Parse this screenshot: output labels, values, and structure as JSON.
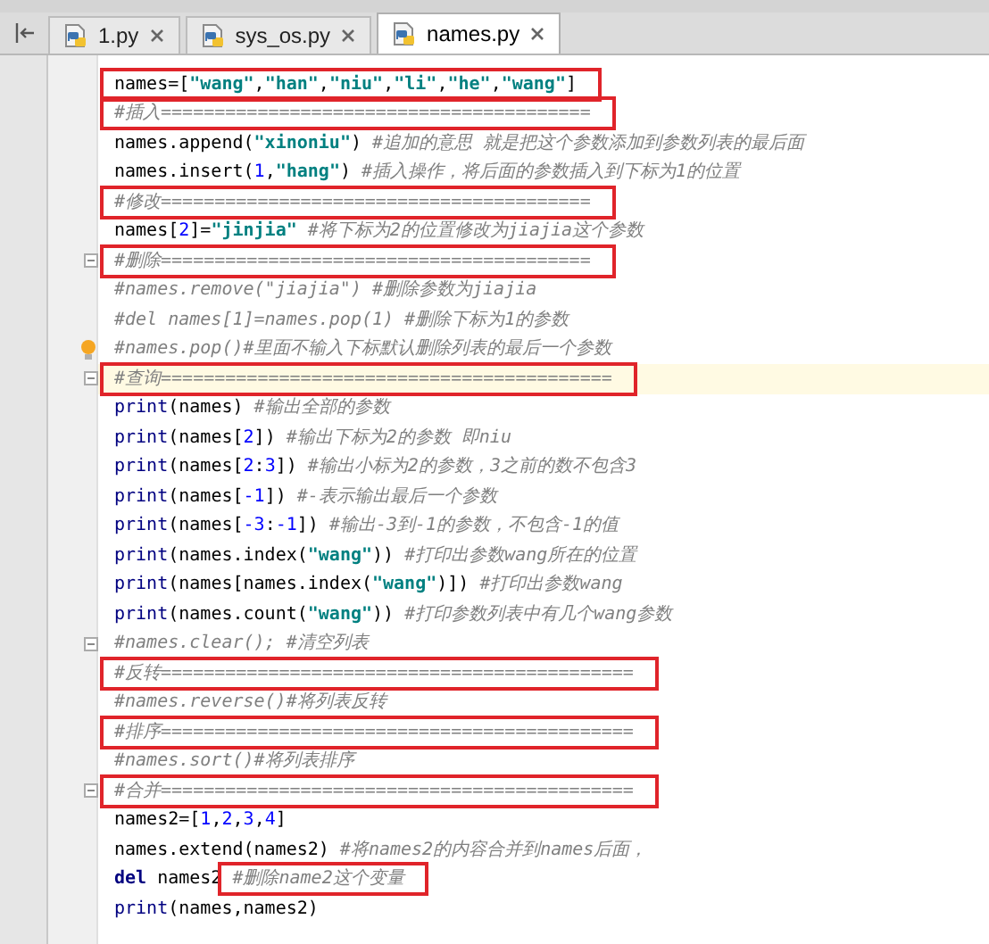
{
  "tabs": [
    {
      "label": "1.py",
      "selected": false
    },
    {
      "label": "sys_os.py",
      "selected": false
    },
    {
      "label": "names.py",
      "selected": true
    }
  ],
  "editor": {
    "lines": [
      {
        "code": [
          {
            "kind": "plain",
            "text": "names=["
          },
          {
            "kind": "string",
            "text": "\"wang\""
          },
          {
            "kind": "plain",
            "text": ","
          },
          {
            "kind": "string",
            "text": "\"han\""
          },
          {
            "kind": "plain",
            "text": ","
          },
          {
            "kind": "string",
            "text": "\"niu\""
          },
          {
            "kind": "plain",
            "text": ","
          },
          {
            "kind": "string",
            "text": "\"li\""
          },
          {
            "kind": "plain",
            "text": ","
          },
          {
            "kind": "string",
            "text": "\"he\""
          },
          {
            "kind": "plain",
            "text": ","
          },
          {
            "kind": "string",
            "text": "\"wang\""
          },
          {
            "kind": "plain",
            "text": "]"
          }
        ],
        "boxed": true
      },
      {
        "comment": "#插入========================================",
        "boxed": true
      },
      {
        "code": [
          {
            "kind": "plain",
            "text": "names.append("
          },
          {
            "kind": "string",
            "text": "\"xinoniu\""
          },
          {
            "kind": "plain",
            "text": ")"
          }
        ],
        "comment": "#追加的意思 就是把这个参数添加到参数列表的最后面"
      },
      {
        "code": [
          {
            "kind": "plain",
            "text": "names.insert("
          },
          {
            "kind": "number",
            "text": "1"
          },
          {
            "kind": "plain",
            "text": ","
          },
          {
            "kind": "string",
            "text": "\"hang\""
          },
          {
            "kind": "plain",
            "text": ")"
          }
        ],
        "comment": "#插入操作，将后面的参数插入到下标为1的位置"
      },
      {
        "comment": "#修改========================================",
        "boxed": true
      },
      {
        "code": [
          {
            "kind": "plain",
            "text": "names["
          },
          {
            "kind": "number",
            "text": "2"
          },
          {
            "kind": "plain",
            "text": "]="
          },
          {
            "kind": "string",
            "text": "\"jinjia\""
          }
        ],
        "comment": "#将下标为2的位置修改为jiajia这个参数"
      },
      {
        "comment": "#删除========================================",
        "boxed": true,
        "fold": true
      },
      {
        "comment": "#names.remove(\"jiajia\")  #删除参数为jiajia"
      },
      {
        "comment": "#del names[1]=names.pop(1) #删除下标为1的参数"
      },
      {
        "comment": "#names.pop()#里面不输入下标默认删除列表的最后一个参数",
        "bulb": true
      },
      {
        "comment": "#查询==========================================",
        "boxed": true,
        "fold": true,
        "current": true
      },
      {
        "code": [
          {
            "kind": "builtin",
            "text": "print"
          },
          {
            "kind": "plain",
            "text": "(names)"
          }
        ],
        "comment": "#输出全部的参数"
      },
      {
        "code": [
          {
            "kind": "builtin",
            "text": "print"
          },
          {
            "kind": "plain",
            "text": "(names["
          },
          {
            "kind": "number",
            "text": "2"
          },
          {
            "kind": "plain",
            "text": "])"
          }
        ],
        "comment": "#输出下标为2的参数 即niu"
      },
      {
        "code": [
          {
            "kind": "builtin",
            "text": "print"
          },
          {
            "kind": "plain",
            "text": "(names["
          },
          {
            "kind": "number",
            "text": "2"
          },
          {
            "kind": "plain",
            "text": ":"
          },
          {
            "kind": "number",
            "text": "3"
          },
          {
            "kind": "plain",
            "text": "])"
          }
        ],
        "comment": "#输出小标为2的参数，3之前的数不包含3"
      },
      {
        "code": [
          {
            "kind": "builtin",
            "text": "print"
          },
          {
            "kind": "plain",
            "text": "(names["
          },
          {
            "kind": "number",
            "text": "-1"
          },
          {
            "kind": "plain",
            "text": "])"
          }
        ],
        "comment": "#-表示输出最后一个参数"
      },
      {
        "code": [
          {
            "kind": "builtin",
            "text": "print"
          },
          {
            "kind": "plain",
            "text": "(names["
          },
          {
            "kind": "number",
            "text": "-3"
          },
          {
            "kind": "plain",
            "text": ":"
          },
          {
            "kind": "number",
            "text": "-1"
          },
          {
            "kind": "plain",
            "text": "])"
          }
        ],
        "comment": "#输出-3到-1的参数，不包含-1的值"
      },
      {
        "code": [
          {
            "kind": "builtin",
            "text": "print"
          },
          {
            "kind": "plain",
            "text": "(names.index("
          },
          {
            "kind": "string",
            "text": "\"wang\""
          },
          {
            "kind": "plain",
            "text": "))"
          }
        ],
        "comment": "#打印出参数wang所在的位置"
      },
      {
        "code": [
          {
            "kind": "builtin",
            "text": "print"
          },
          {
            "kind": "plain",
            "text": "(names[names.index("
          },
          {
            "kind": "string",
            "text": "\"wang\""
          },
          {
            "kind": "plain",
            "text": ")])"
          }
        ],
        "comment": "#打印出参数wang"
      },
      {
        "code": [
          {
            "kind": "builtin",
            "text": "print"
          },
          {
            "kind": "plain",
            "text": "(names.count("
          },
          {
            "kind": "string",
            "text": "\"wang\""
          },
          {
            "kind": "plain",
            "text": "))"
          }
        ],
        "comment": "#打印参数列表中有几个wang参数"
      },
      {
        "comment": "#names.clear(); #清空列表",
        "fold": true
      },
      {
        "comment": "#反转============================================",
        "boxed": true
      },
      {
        "comment": "#names.reverse()#将列表反转"
      },
      {
        "comment": "#排序============================================",
        "boxed": true
      },
      {
        "comment": "#names.sort()#将列表排序"
      },
      {
        "comment": "#合并============================================",
        "boxed": true,
        "fold": true
      },
      {
        "code": [
          {
            "kind": "plain",
            "text": "names2=["
          },
          {
            "kind": "number",
            "text": "1"
          },
          {
            "kind": "plain",
            "text": ","
          },
          {
            "kind": "number",
            "text": "2"
          },
          {
            "kind": "plain",
            "text": ","
          },
          {
            "kind": "number",
            "text": "3"
          },
          {
            "kind": "plain",
            "text": ","
          },
          {
            "kind": "number",
            "text": "4"
          },
          {
            "kind": "plain",
            "text": "]"
          }
        ]
      },
      {
        "code": [
          {
            "kind": "plain",
            "text": "names.extend(names2)"
          }
        ],
        "comment": "#将names2的内容合并到names后面，"
      },
      {
        "code": [
          {
            "kind": "keyword",
            "text": "del"
          },
          {
            "kind": "plain",
            "text": " names2"
          }
        ],
        "comment": "#删除name2这个变量",
        "comment_boxed": true
      },
      {
        "code": [
          {
            "kind": "builtin",
            "text": "print"
          },
          {
            "kind": "plain",
            "text": "(names,names2)"
          }
        ]
      }
    ]
  }
}
